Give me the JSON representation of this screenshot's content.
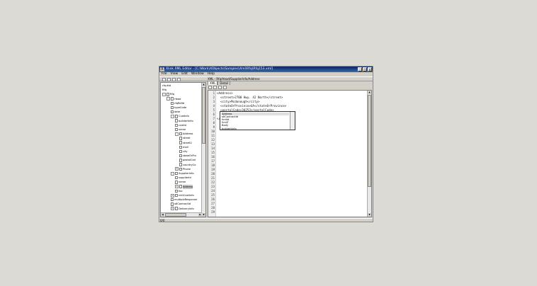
{
  "window": {
    "title": "Xlink XML Editor - [C:\\Work\\XObjects\\Samples\\Xml\\Rfq\\Rfq153.xml]",
    "app_icon": "X",
    "controls": [
      "_",
      "□",
      "×"
    ]
  },
  "menu": [
    "File",
    "View",
    "Edit",
    "Window",
    "Help"
  ],
  "tree": {
    "nodes": [
      {
        "label": "rfq.dtd",
        "indent": 0,
        "toggle": "",
        "icon": false
      },
      {
        "label": "Rfq",
        "indent": 0,
        "toggle": "",
        "icon": false
      },
      {
        "label": "Rfq",
        "indent": 0,
        "toggle": "-",
        "icon": true
      },
      {
        "label": "Head",
        "indent": 1,
        "toggle": "-",
        "icon": true
      },
      {
        "label": "rfqRefId",
        "indent": 2,
        "toggle": "",
        "icon": true
      },
      {
        "label": "typeCode",
        "indent": 2,
        "toggle": "",
        "icon": true
      },
      {
        "label": "date",
        "indent": 2,
        "toggle": "",
        "icon": true
      },
      {
        "label": "CustInfo",
        "indent": 2,
        "toggle": "-",
        "icon": true
      },
      {
        "label": "buildertInfo",
        "indent": 3,
        "toggle": "",
        "icon": true
      },
      {
        "label": "custId",
        "indent": 3,
        "toggle": "",
        "icon": true
      },
      {
        "label": "name",
        "indent": 3,
        "toggle": "",
        "icon": true
      },
      {
        "label": "Address",
        "indent": 3,
        "toggle": "-",
        "icon": true
      },
      {
        "label": "street",
        "indent": 4,
        "toggle": "",
        "icon": true
      },
      {
        "label": "street2",
        "indent": 4,
        "toggle": "",
        "icon": true
      },
      {
        "label": "mail",
        "indent": 4,
        "toggle": "",
        "icon": true
      },
      {
        "label": "city",
        "indent": 4,
        "toggle": "",
        "icon": true
      },
      {
        "label": "stateOrPrv",
        "indent": 4,
        "toggle": "",
        "icon": true
      },
      {
        "label": "postalCod",
        "indent": 4,
        "toggle": "",
        "icon": true
      },
      {
        "label": "countryCo",
        "indent": 4,
        "toggle": "",
        "icon": true
      },
      {
        "label": "Phone",
        "indent": 3,
        "toggle": "+",
        "icon": true
      },
      {
        "label": "SupplierInfo",
        "indent": 2,
        "toggle": "-",
        "icon": true
      },
      {
        "label": "supplierId",
        "indent": 3,
        "toggle": "",
        "icon": true
      },
      {
        "label": "name",
        "indent": 3,
        "toggle": "",
        "icon": true
      },
      {
        "label": "Address",
        "indent": 3,
        "toggle": "+",
        "icon": true,
        "selected": true
      },
      {
        "label": "fax",
        "indent": 3,
        "toggle": "",
        "icon": true
      },
      {
        "label": "rcktCostInfo",
        "indent": 2,
        "toggle": "+",
        "icon": true
      },
      {
        "label": "multipleResponse",
        "indent": 2,
        "toggle": "",
        "icon": true
      },
      {
        "label": "stlContractId",
        "indent": 2,
        "toggle": "",
        "icon": true
      },
      {
        "label": "DeliveryInfo",
        "indent": 2,
        "toggle": "+",
        "icon": true
      }
    ]
  },
  "path": "XML - Rfq/Head/SupplierInfo/Address",
  "tabs": [
    "XML",
    "Detail"
  ],
  "editor": {
    "line_numbers": [
      "1",
      "2",
      "3",
      "4",
      "5",
      "6",
      "7",
      "8",
      "9",
      "10",
      "11",
      "12",
      "13",
      "14",
      "15",
      "16",
      "17",
      "18",
      "19",
      "20",
      "21",
      "22",
      "23",
      "24",
      "25",
      "26",
      "27",
      "28",
      "29"
    ],
    "code_lines": [
      "<Address>",
      "  <street>2700 Hwy. 42 North</street>",
      "  <city>Mcdonough</city>",
      "  <stateOrProvince>GA</stateOrProvince>",
      "  <postalCode>30253</postalCode>",
      "  |",
      "</Address>"
    ]
  },
  "autocomplete": [
    "Address",
    "stlContractId",
    "fcntId",
    "fcntZ",
    "Body",
    "buildertInfo"
  ],
  "status": "0/0"
}
